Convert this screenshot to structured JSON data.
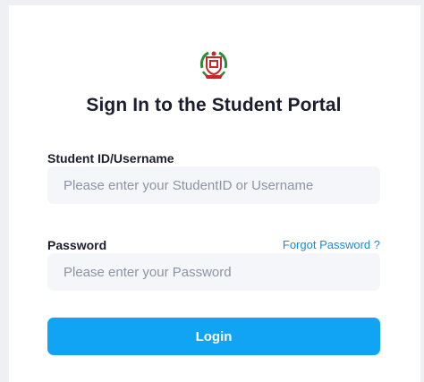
{
  "login_form": {
    "title": "Sign In to the Student Portal",
    "username_label": "Student ID/Username",
    "username_placeholder": "Please enter your StudentID or Username",
    "username_value": "",
    "password_label": "Password",
    "password_placeholder": "Please enter your Password",
    "password_value": "",
    "forgot_password_label": "Forgot Password ?",
    "login_button_label": "Login"
  },
  "logo": {
    "icon": "school-crest-icon"
  },
  "colors": {
    "accent": "#11a4f4",
    "link": "#1a8ad6",
    "title_text": "#1b1e2e",
    "input_background": "#f4f6fa",
    "page_background": "#eef0f4"
  }
}
